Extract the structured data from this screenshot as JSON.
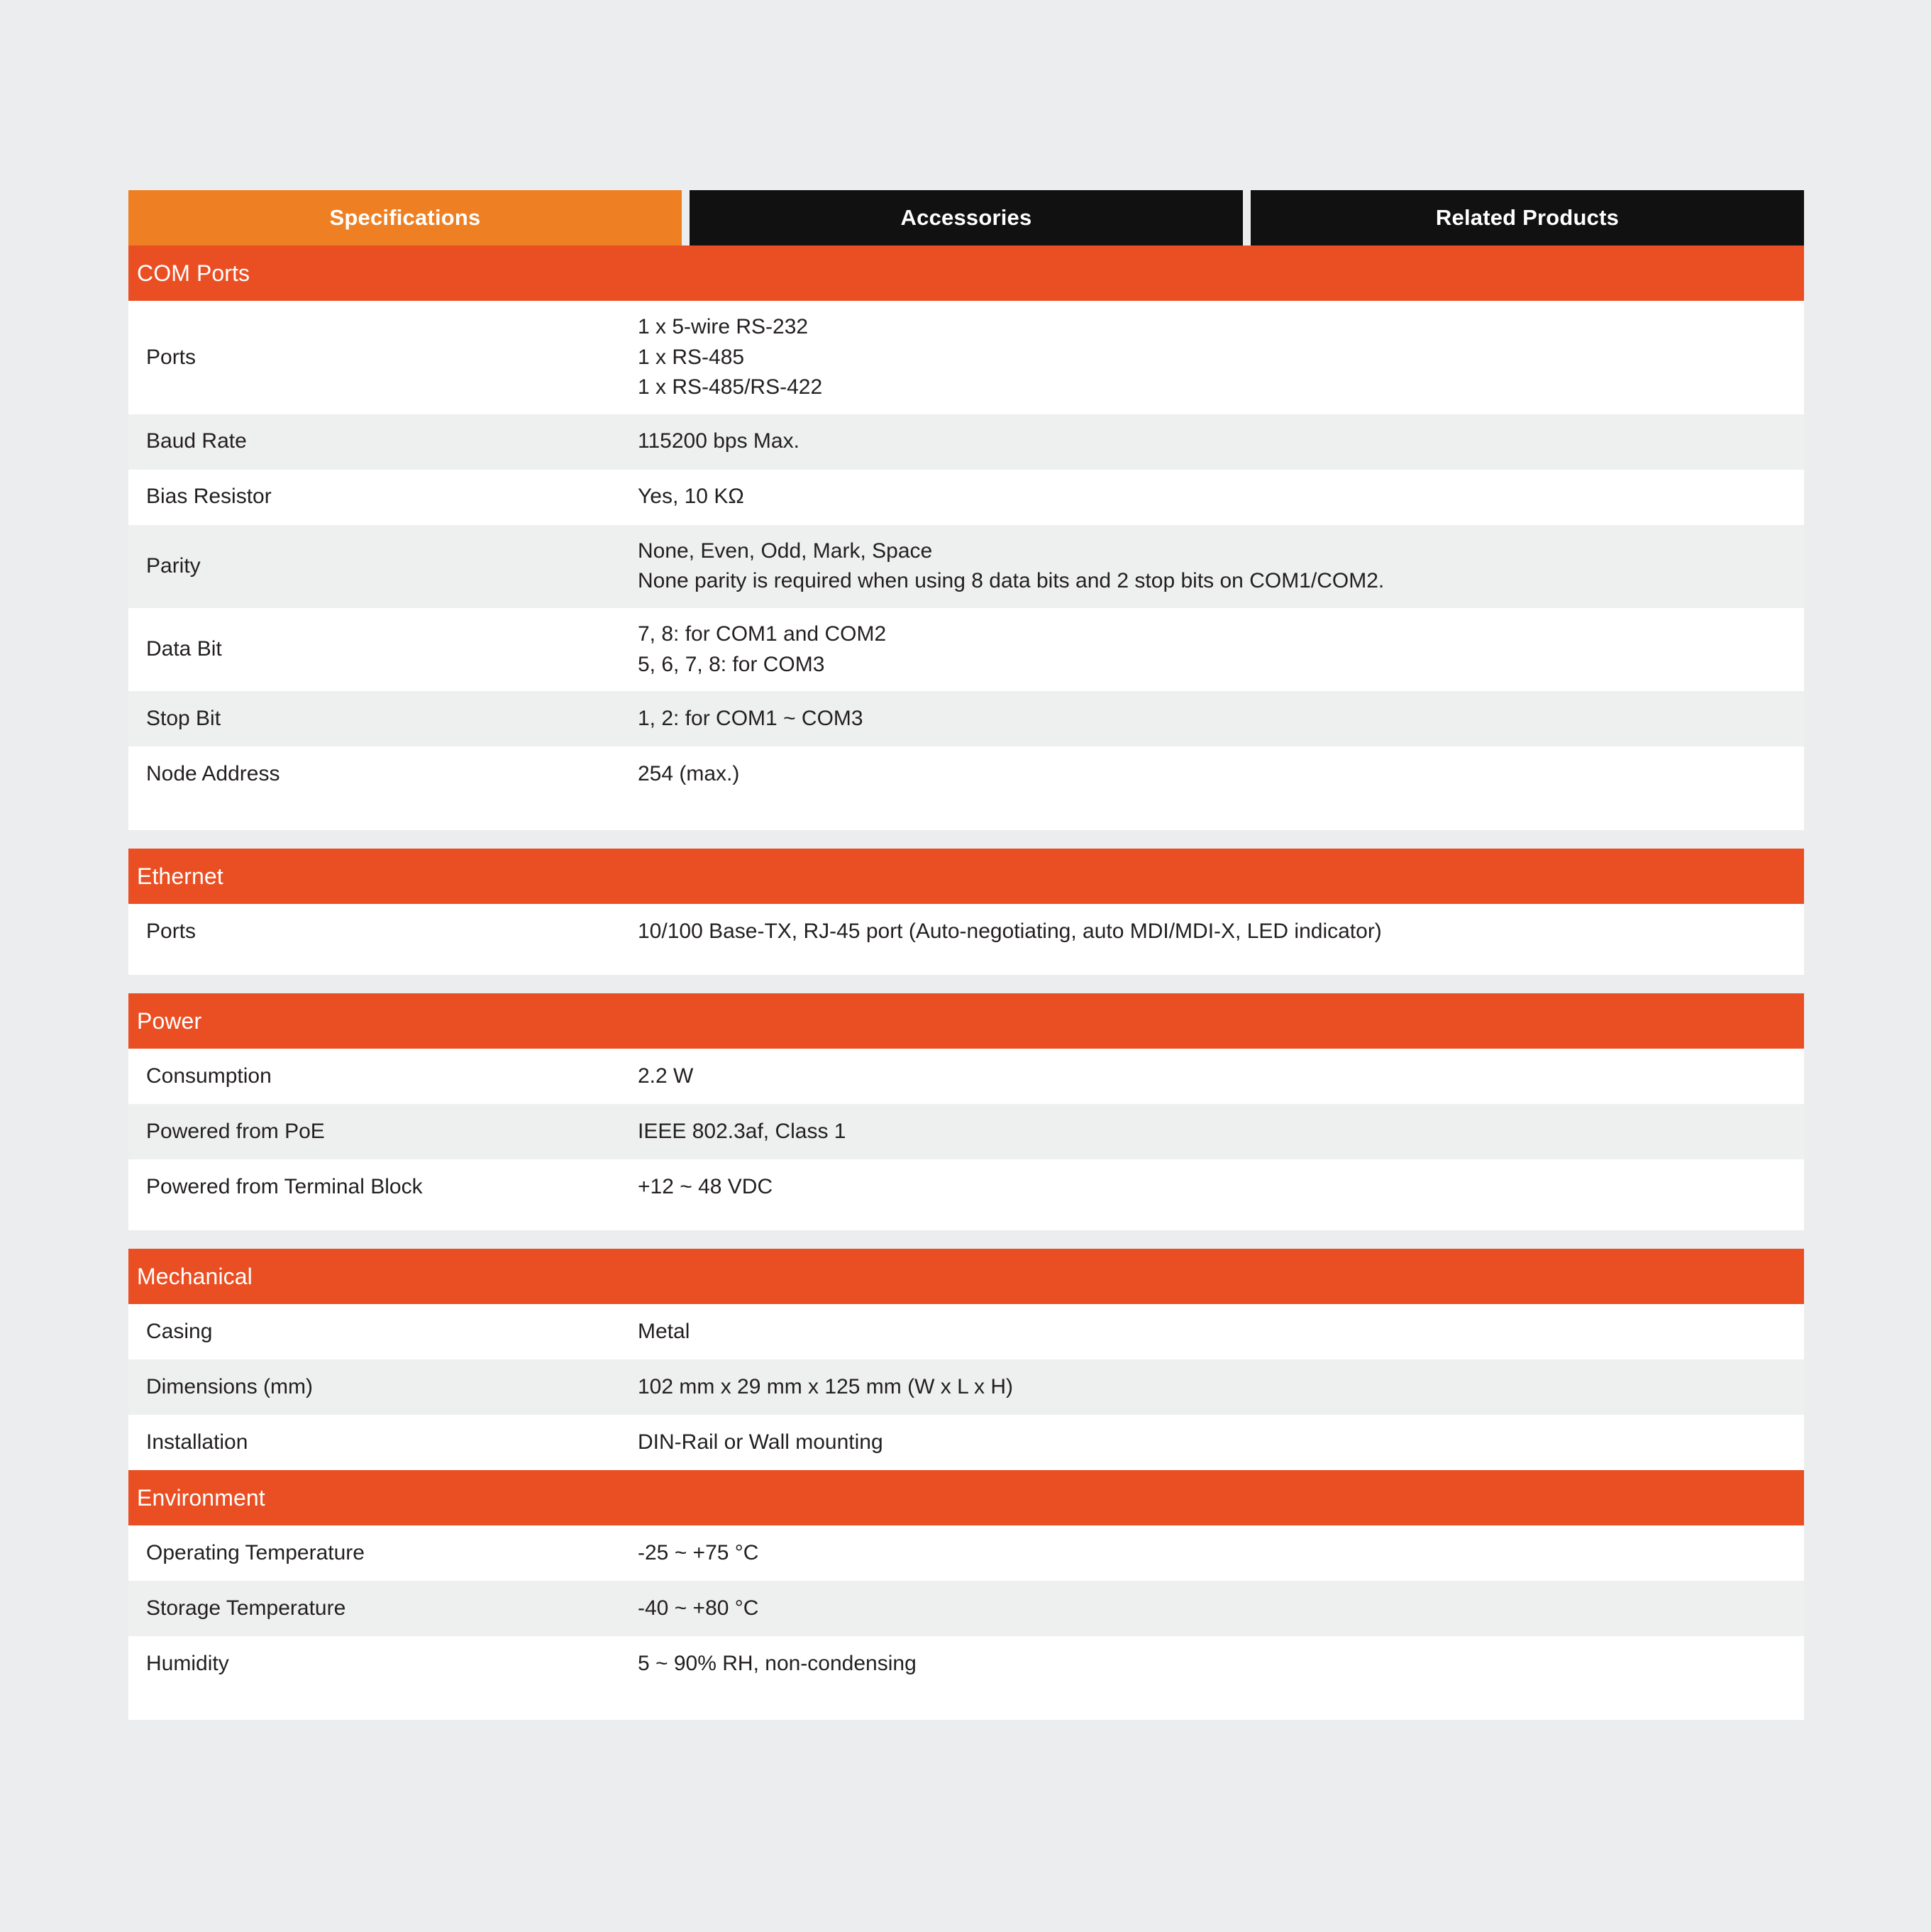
{
  "tabs": [
    {
      "label": "Specifications",
      "active": true
    },
    {
      "label": "Accessories",
      "active": false
    },
    {
      "label": "Related Products",
      "active": false
    }
  ],
  "colors": {
    "tab_active": "#ee7f23",
    "tab_inactive": "#111111",
    "section_header": "#ea4f24",
    "row_alt": "#eeefef",
    "row_base": "#ffffff",
    "page_background": "#ecedee",
    "text": "#231f20"
  },
  "sections": [
    {
      "title": "COM Ports",
      "rows": [
        {
          "label": "Ports",
          "value": [
            "1 x 5-wire RS-232",
            "1 x RS-485",
            "1 x RS-485/RS-422"
          ]
        },
        {
          "label": "Baud Rate",
          "value": [
            "115200 bps Max."
          ]
        },
        {
          "label": "Bias Resistor",
          "value": [
            "Yes, 10 KΩ"
          ]
        },
        {
          "label": "Parity",
          "value": [
            "None, Even, Odd, Mark, Space",
            "None parity is required when using 8 data bits and 2 stop bits on COM1/COM2."
          ]
        },
        {
          "label": "Data Bit",
          "value": [
            "7, 8: for COM1 and COM2",
            "5, 6, 7, 8: for COM3"
          ]
        },
        {
          "label": "Stop Bit",
          "value": [
            "1, 2: for COM1 ~ COM3"
          ]
        },
        {
          "label": "Node Address",
          "value": [
            "254 (max.)"
          ]
        }
      ]
    },
    {
      "title": "Ethernet",
      "rows": [
        {
          "label": "Ports",
          "value": [
            "10/100 Base-TX, RJ-45 port (Auto-negotiating, auto MDI/MDI-X, LED indicator)"
          ]
        }
      ]
    },
    {
      "title": "Power",
      "rows": [
        {
          "label": "Consumption",
          "value": [
            "2.2 W"
          ]
        },
        {
          "label": "Powered from PoE",
          "value": [
            "IEEE 802.3af, Class 1"
          ]
        },
        {
          "label": "Powered from Terminal Block",
          "value": [
            "+12 ~ 48 VDC"
          ]
        }
      ]
    },
    {
      "title": "Mechanical",
      "rows": [
        {
          "label": "Casing",
          "value": [
            "Metal"
          ]
        },
        {
          "label": "Dimensions (mm)",
          "value": [
            "102 mm x 29 mm x 125 mm (W x L x H)"
          ]
        },
        {
          "label": "Installation",
          "value": [
            "DIN-Rail or Wall mounting"
          ]
        }
      ]
    },
    {
      "title": "Environment",
      "rows": [
        {
          "label": "Operating Temperature",
          "value": [
            "-25 ~ +75 °C"
          ]
        },
        {
          "label": "Storage Temperature",
          "value": [
            "-40 ~ +80 °C"
          ]
        },
        {
          "label": "Humidity",
          "value": [
            "5 ~ 90% RH, non-condensing"
          ]
        }
      ]
    }
  ]
}
